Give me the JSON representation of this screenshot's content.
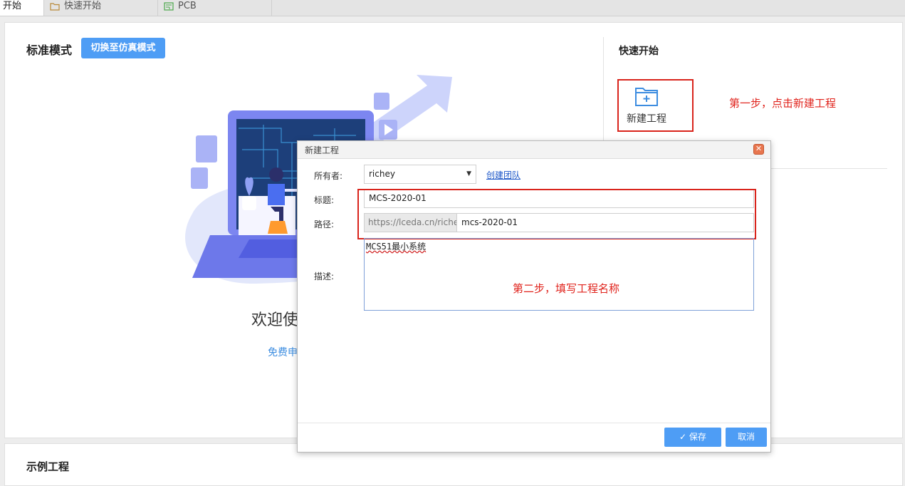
{
  "tabs": [
    {
      "label": "开始",
      "icon": "home"
    },
    {
      "label": "快速开始",
      "icon": "folder-icon"
    },
    {
      "label": "PCB",
      "icon": "pcb-icon"
    }
  ],
  "main": {
    "mode_title": "标准模式",
    "switch_button": "切换至仿真模式",
    "welcome_text": "欢迎使",
    "free_link": "免费申",
    "quick_start_title": "快速开始",
    "new_project_label": "新建工程",
    "example_title": "示例工程"
  },
  "annotations": {
    "step1": "第一步，点击新建工程",
    "step2": "第二步，填写工程名称"
  },
  "dialog": {
    "title": "新建工程",
    "owner_label": "所有者:",
    "owner_value": "richey",
    "create_team_link": "创建团队",
    "title_label": "标题:",
    "title_value": "MCS-2020-01",
    "path_label": "路径:",
    "path_prefix": "https://lceda.cn/richey/",
    "path_value": "mcs-2020-01",
    "desc_label": "描述:",
    "desc_value": "MCS51最小系统",
    "save_button": "保存",
    "cancel_button": "取消"
  },
  "colors": {
    "accent": "#4e9df5",
    "annotation_red": "#e0231c",
    "link": "#1a55c8"
  }
}
